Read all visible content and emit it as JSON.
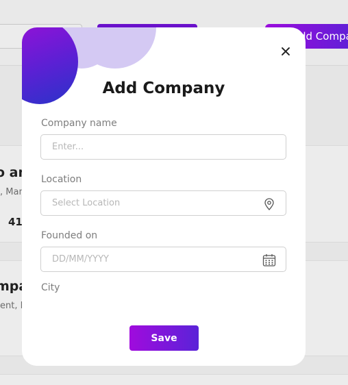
{
  "background": {
    "add_button_label": "Add Company",
    "card1": {
      "title": "o an",
      "subtitle": ", Man",
      "number": "41"
    },
    "card2": {
      "title": "mpa",
      "subtitle": "ent, E"
    }
  },
  "modal": {
    "title": "Add Company",
    "fields": {
      "company_name": {
        "label": "Company name",
        "placeholder": "Enter...",
        "value": ""
      },
      "location": {
        "label": "Location",
        "placeholder": "Select Location",
        "value": "",
        "icon": "location-pin-icon"
      },
      "founded_on": {
        "label": "Founded on",
        "placeholder": "DD/MM/YYYY",
        "value": "",
        "icon": "calendar-icon"
      },
      "city": {
        "label": "City"
      }
    },
    "save_label": "Save",
    "colors": {
      "accent_start": "#a00bdd",
      "accent_end": "#5a23d8"
    }
  }
}
